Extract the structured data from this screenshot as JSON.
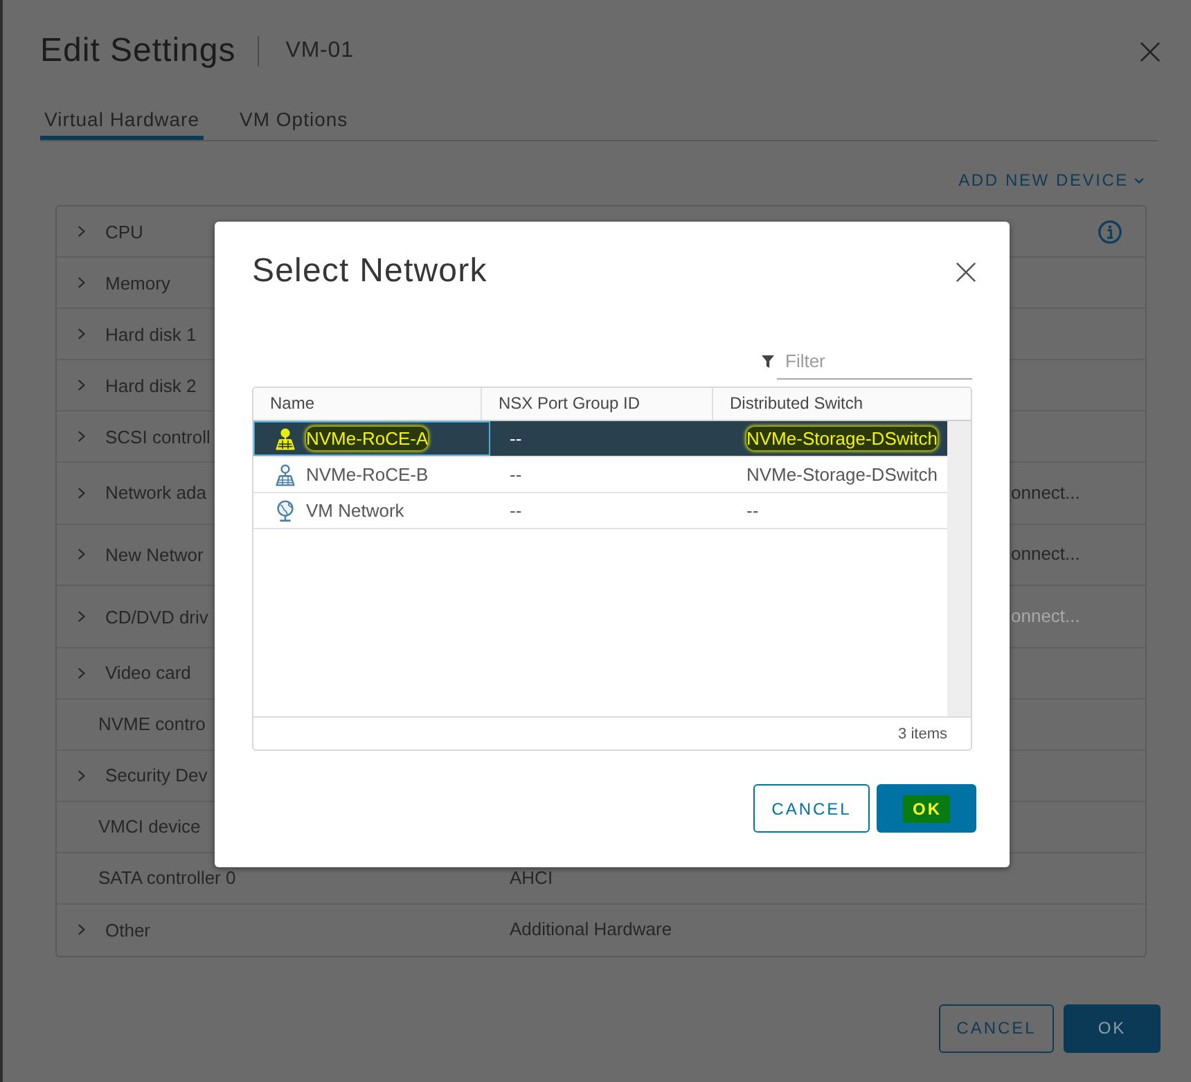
{
  "window": {
    "title": "Edit Settings",
    "subtitle": "VM-01"
  },
  "tabs": [
    {
      "label": "Virtual Hardware",
      "selected": true
    },
    {
      "label": "VM Options",
      "selected": false
    }
  ],
  "add_device": {
    "label": "ADD NEW DEVICE"
  },
  "hardware": [
    {
      "label": "CPU",
      "expandable": true
    },
    {
      "label": "Memory",
      "expandable": true
    },
    {
      "label": "Hard disk 1",
      "expandable": true
    },
    {
      "label": "Hard disk 2",
      "expandable": true
    },
    {
      "label": "SCSI controll",
      "expandable": true
    },
    {
      "label": "Network ada",
      "expandable": true,
      "connect": {
        "label": "onnect...",
        "disabled": false
      }
    },
    {
      "label": "New Networ",
      "expandable": true,
      "connect": {
        "label": "onnect...",
        "disabled": false
      }
    },
    {
      "label": "CD/DVD driv",
      "expandable": true,
      "connect": {
        "label": "onnect...",
        "disabled": true
      }
    },
    {
      "label": "Video card",
      "expandable": true
    },
    {
      "label": "NVME contro",
      "expandable": false
    },
    {
      "label": "Security Dev",
      "expandable": true
    },
    {
      "label": "VMCI device",
      "expandable": false
    },
    {
      "label": "SATA controller 0",
      "expandable": false,
      "value": "AHCI"
    },
    {
      "label": "Other",
      "expandable": true,
      "value": "Additional Hardware"
    }
  ],
  "buttons": [
    {
      "label": "CANCEL",
      "kind": "secondary"
    },
    {
      "label": "OK",
      "kind": "primary"
    }
  ],
  "dialog": {
    "title": "Select Network",
    "filter": {
      "placeholder": "Filter"
    },
    "columns": [
      "Name",
      "NSX Port Group ID",
      "Distributed Switch"
    ],
    "rows": [
      {
        "kind": "port-group",
        "name": "NVMe-RoCE-A",
        "nsx_port_group_id": "--",
        "distributed_switch": "NVMe-Storage-DSwitch",
        "selected": true,
        "highlighted": true
      },
      {
        "kind": "port-group",
        "name": "NVMe-RoCE-B",
        "nsx_port_group_id": "--",
        "distributed_switch": "NVMe-Storage-DSwitch",
        "selected": false,
        "highlighted": false
      },
      {
        "kind": "standard",
        "name": "VM Network",
        "nsx_port_group_id": "--",
        "distributed_switch": "--",
        "selected": false,
        "highlighted": false
      }
    ],
    "item_count": "3 items",
    "buttons": [
      {
        "label": "CANCEL",
        "kind": "secondary",
        "highlighted": false
      },
      {
        "label": "OK",
        "kind": "primary",
        "highlighted": true
      }
    ]
  }
}
